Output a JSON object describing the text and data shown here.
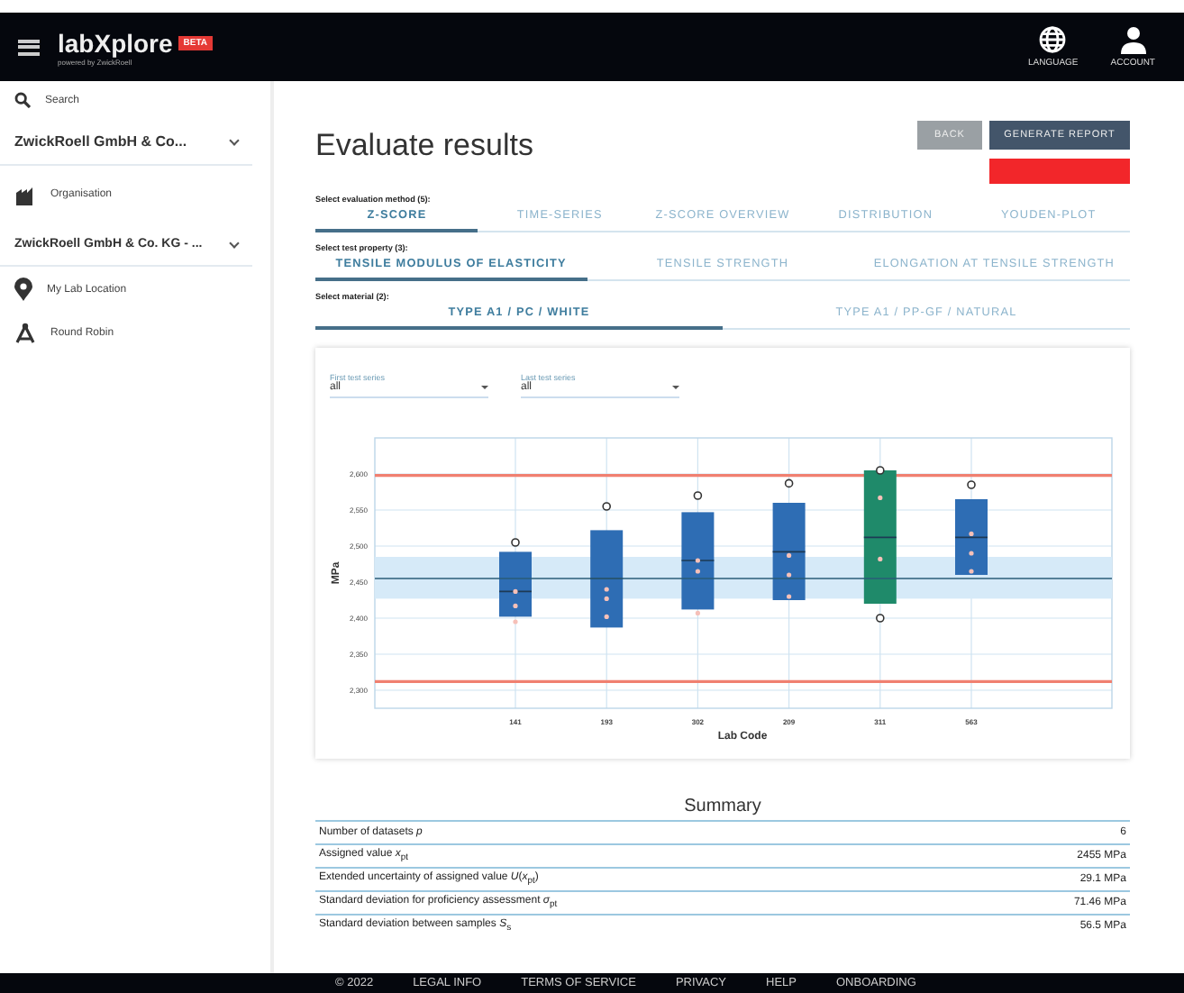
{
  "header": {
    "logo": "labXplore",
    "badge": "BETA",
    "tagline": "powered by ZwickRoell",
    "actions": [
      {
        "label": "LANGUAGE",
        "kind": "globe"
      },
      {
        "label": "ACCOUNT",
        "kind": "person"
      }
    ]
  },
  "sidebar": {
    "search": "Search",
    "company": "ZwickRoell GmbH & Co...",
    "items": [
      {
        "label": "Organisation",
        "kind": "building"
      }
    ],
    "org_select": "ZwickRoell GmbH & Co. KG - ...",
    "links": [
      {
        "label": "My Lab Location",
        "kind": "pin"
      },
      {
        "label": "Round Robin",
        "kind": "robin"
      }
    ]
  },
  "page": {
    "title": "Evaluate results",
    "buttons": [
      {
        "label": "BACK",
        "kind": "muted"
      },
      {
        "label": "GENERATE REPORT",
        "kind": "primary"
      }
    ],
    "alert_button": {
      "kind": "danger"
    }
  },
  "selectors": [
    {
      "label": "Select evaluation method (5):",
      "tabs": [
        {
          "label": "Z-SCORE",
          "selected": true
        },
        {
          "label": "TIME-SERIES",
          "selected": false
        },
        {
          "label": "Z-SCORE OVERVIEW",
          "selected": false
        },
        {
          "label": "DISTRIBUTION",
          "selected": false
        },
        {
          "label": "YOUDEN-PLOT",
          "selected": false
        }
      ]
    },
    {
      "label": "Select test property (3):",
      "tabs": [
        {
          "label": "TENSILE MODULUS OF ELASTICITY",
          "selected": true
        },
        {
          "label": "TENSILE STRENGTH",
          "selected": false
        },
        {
          "label": "ELONGATION AT TENSILE STRENGTH",
          "selected": false
        }
      ]
    },
    {
      "label": "Select material (2):",
      "tabs": [
        {
          "label": "TYPE A1 / PC / WHITE",
          "selected": true
        },
        {
          "label": "TYPE A1 / PP-GF / NATURAL",
          "selected": false
        }
      ]
    }
  ],
  "filters": [
    {
      "label": "First test series",
      "value": "all"
    },
    {
      "label": "Last test series",
      "value": "all"
    }
  ],
  "chart": {
    "xlabel": "Lab Code",
    "ylabel": "MPa",
    "categories": [
      "141",
      "193",
      "302",
      "209",
      "311",
      "563"
    ],
    "yticks": [
      "2,600",
      "2,550",
      "2,500",
      "2,450",
      "2,400",
      "2,350",
      "2,300"
    ]
  },
  "summary": {
    "title": "Summary",
    "rows": [
      {
        "label": "Number of datasets *p*",
        "value": "6"
      },
      {
        "label": "Assigned value *x*$_{pt}$",
        "value": "2455 MPa"
      },
      {
        "label": "Extended uncertainty of assigned value *U*(*x*$_{pt}$)",
        "value": "29.1 MPa"
      },
      {
        "label": "Standard deviation for proficiency assessment *σ*$_{pt}$",
        "value": "71.46 MPa"
      },
      {
        "label": "Standard deviation between samples *S*$_{s}$",
        "value": "56.5 MPa"
      }
    ]
  },
  "footer": [
    "© 2022",
    "LEGAL INFO",
    "TERMS OF SERVICE",
    "PRIVACY",
    "HELP",
    "ONBOARDING"
  ]
}
